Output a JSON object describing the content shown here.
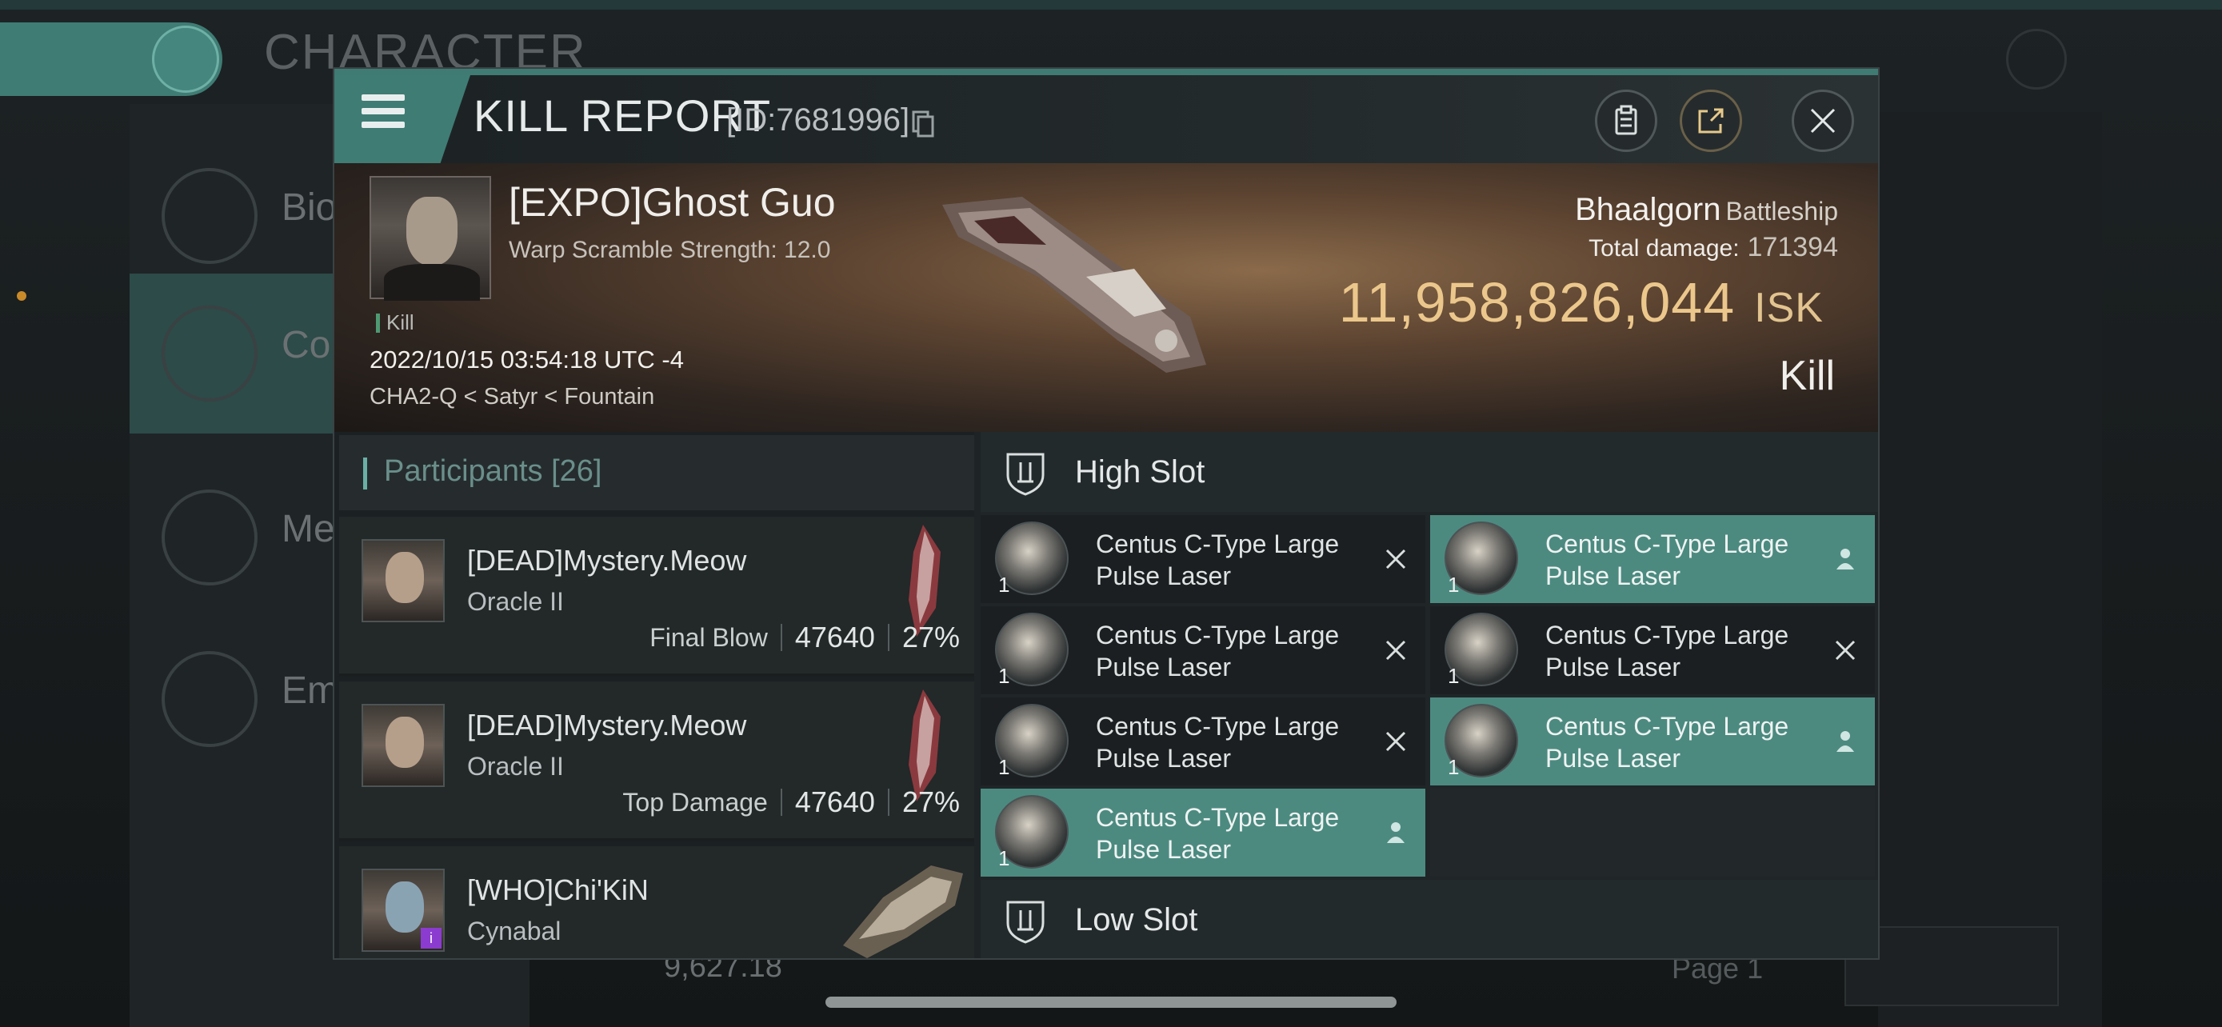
{
  "background": {
    "screen_title": "CHARACTER",
    "side_items": [
      {
        "label": "Bio",
        "icon": "list-icon"
      },
      {
        "label": "Co",
        "icon": "crossed-swords-icon"
      },
      {
        "label": "Me",
        "icon": "star-hexagon-icon"
      },
      {
        "label": "Em",
        "icon": "star-laurel-icon"
      }
    ],
    "bottom_value": "9,627.18",
    "bottom_page": "Page 1"
  },
  "dialog": {
    "title": "KILL REPORT",
    "id_text": "[ID:7681996]"
  },
  "victim": {
    "name": "[EXPO]Ghost Guo",
    "sub": "Warp Scramble Strength: 12.0",
    "tag": "Kill",
    "date": "2022/10/15 03:54:18 UTC -4",
    "location": "CHA2-Q < Satyr < Fountain",
    "ship": "Bhaalgorn",
    "ship_class": "Battleship",
    "total_damage_label": "Total damage:",
    "total_damage": "171394",
    "isk_value": "11,958,826,044",
    "isk_unit": "ISK",
    "result": "Kill"
  },
  "participants": {
    "title": "Participants",
    "count": "[26]",
    "rows": [
      {
        "name": "[DEAD]Mystery.Meow",
        "ship": "Oracle II",
        "role": "Final Blow",
        "damage": "47640",
        "pct": "27%"
      },
      {
        "name": "[DEAD]Mystery.Meow",
        "ship": "Oracle II",
        "role": "Top Damage",
        "damage": "47640",
        "pct": "27%"
      },
      {
        "name": "[WHO]Chi'KiN",
        "ship": "Cynabal",
        "role": "",
        "damage": "",
        "pct": ""
      }
    ]
  },
  "slots": {
    "high_title": "High Slot",
    "low_title": "Low Slot",
    "modules": [
      {
        "line1": "Centus C-Type Large",
        "line2": "Pulse Laser",
        "qty": "1",
        "state": "destroyed"
      },
      {
        "line1": "Centus C-Type Large",
        "line2": "Pulse Laser",
        "qty": "1",
        "state": "dropped"
      },
      {
        "line1": "Centus C-Type Large",
        "line2": "Pulse Laser",
        "qty": "1",
        "state": "destroyed"
      },
      {
        "line1": "Centus C-Type Large",
        "line2": "Pulse Laser",
        "qty": "1",
        "state": "destroyed"
      },
      {
        "line1": "Centus C-Type Large",
        "line2": "Pulse Laser",
        "qty": "1",
        "state": "destroyed"
      },
      {
        "line1": "Centus C-Type Large",
        "line2": "Pulse Laser",
        "qty": "1",
        "state": "dropped"
      },
      {
        "line1": "Centus C-Type Large",
        "line2": "Pulse Laser",
        "qty": "1",
        "state": "dropped"
      }
    ]
  },
  "colors": {
    "accent_teal": "#4c8a80",
    "isk_gold": "#ecc78c"
  }
}
